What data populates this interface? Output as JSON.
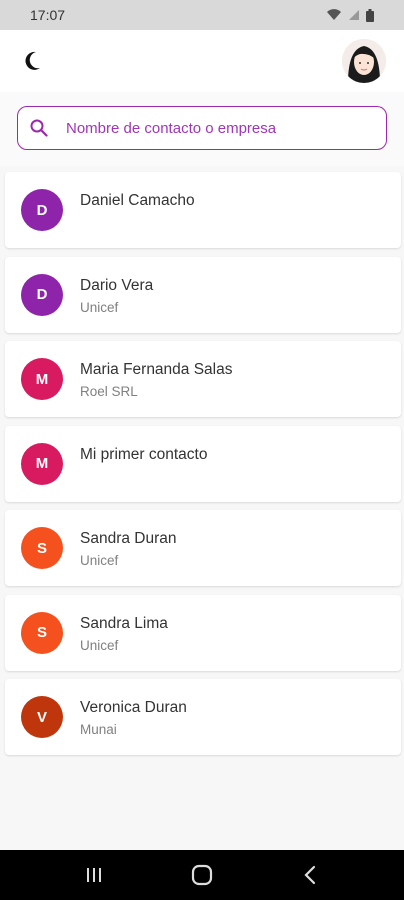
{
  "status_bar": {
    "time": "17:07"
  },
  "search": {
    "placeholder": "Nombre de contacto o empresa"
  },
  "contacts": [
    {
      "initial": "D",
      "name": "Daniel Camacho",
      "company": "",
      "color": "#8e24aa"
    },
    {
      "initial": "D",
      "name": "Dario Vera",
      "company": "Unicef",
      "color": "#8e24aa"
    },
    {
      "initial": "M",
      "name": "Maria Fernanda Salas",
      "company": "Roel SRL",
      "color": "#d81b60"
    },
    {
      "initial": "M",
      "name": "Mi primer contacto",
      "company": "",
      "color": "#d81b60"
    },
    {
      "initial": "S",
      "name": "Sandra Duran",
      "company": "Unicef",
      "color": "#f4511e"
    },
    {
      "initial": "S",
      "name": "Sandra Lima",
      "company": "Unicef",
      "color": "#f4511e"
    },
    {
      "initial": "V",
      "name": "Veronica Duran",
      "company": "Munai",
      "color": "#bf360c"
    }
  ],
  "icons": {
    "theme": "moon-icon",
    "search": "search-icon",
    "nav_recents": "recents-icon",
    "nav_home": "home-icon",
    "nav_back": "back-icon"
  },
  "colors": {
    "accent": "#9c27b0"
  }
}
